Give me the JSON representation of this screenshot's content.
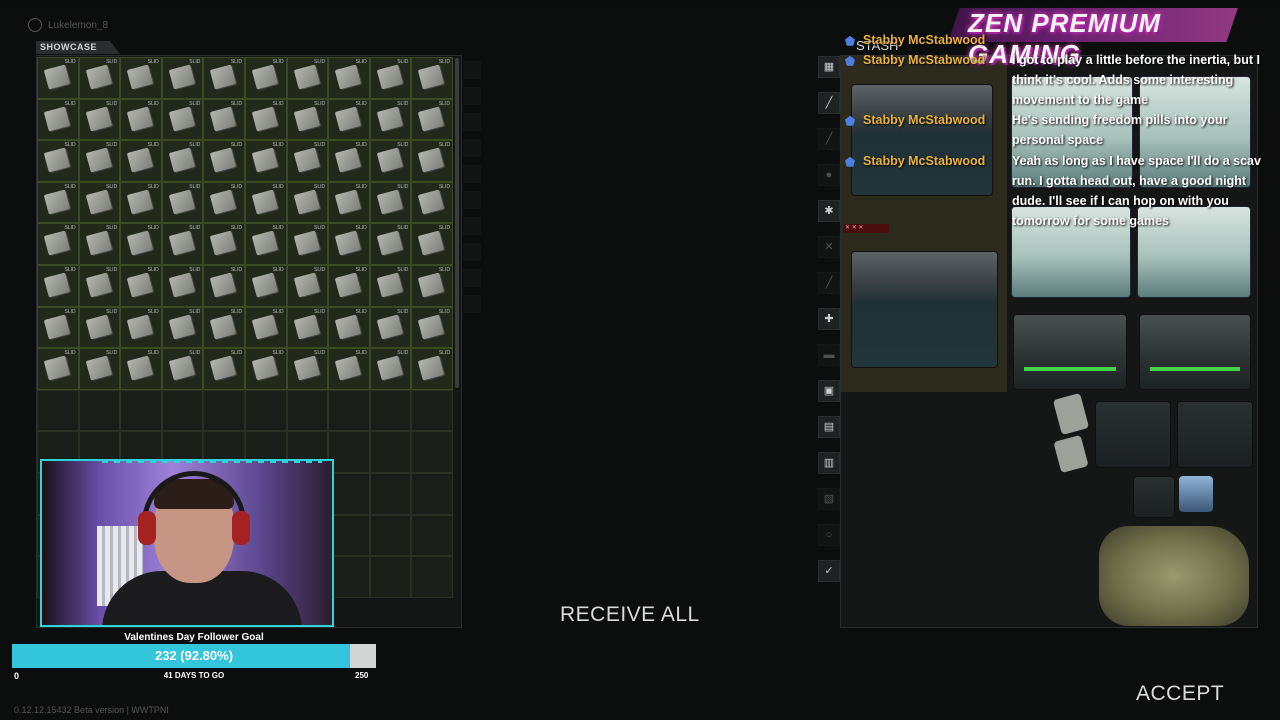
{
  "profile": {
    "name": "Lukelemon_8"
  },
  "showcase": {
    "tab_label": "SHOWCASE",
    "item_tag": "SLID",
    "filled_rows": 8,
    "empty_rows": 5,
    "columns": 10
  },
  "stash": {
    "title": "STASH"
  },
  "tools": [
    "grid-icon",
    "rifle-icon",
    "knife-icon",
    "gear-icon",
    "crossed-icon",
    "medkit-icon",
    "barrier-icon",
    "backpack-icon",
    "filter-icon",
    "checkmark-icon"
  ],
  "chat": {
    "username": "Stabby McStabwood",
    "messages": [
      {
        "name": "Stabby McStabwood",
        "text": "..."
      },
      {
        "name": "Stabby McStabwood",
        "text": "I got to play a little before the inertia, but I think it's cool. Adds some interesting movement to the game"
      },
      {
        "name": "Stabby McStabwood",
        "text": "He's sending freedom pills into your personal space"
      },
      {
        "name": "Stabby McStabwood",
        "text": "Yeah as long as I have space I'll do a scav run. I gotta head out, have a good night dude. I'll see if I can hop on with you tomorrow for some games"
      }
    ]
  },
  "brand": {
    "text": "ZEN PREMIUM GAMING"
  },
  "goal": {
    "title": "Valentines Day Follower Goal",
    "progress_text": "232 (92.80%)",
    "progress_fraction": 0.928,
    "min": "0",
    "max": "250",
    "days_left": "41 DAYS TO GO"
  },
  "actions": {
    "receive_all": "RECEIVE ALL",
    "accept": "ACCEPT"
  },
  "footer": {
    "version": "0.12.12.15432 Beta version | WWTPNI"
  },
  "colors": {
    "accent": "#33c5db",
    "webcam_border": "#2fd4d6",
    "chat_name": "#e8b23a",
    "brand_glow": "#ff3ecf"
  }
}
